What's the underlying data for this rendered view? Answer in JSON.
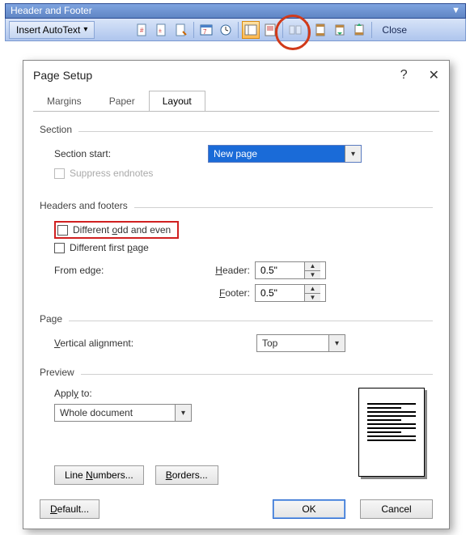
{
  "toolbar": {
    "title": "Header and Footer",
    "autotext_label": "Insert AutoText",
    "close_label": "Close"
  },
  "dialog": {
    "title": "Page Setup",
    "help_symbol": "?",
    "close_symbol": "✕",
    "tabs": {
      "margins": "Margins",
      "paper": "Paper",
      "layout": "Layout"
    },
    "section": {
      "group": "Section",
      "start_label": "Section start:",
      "start_value": "New page",
      "suppress_label": "Suppress endnotes"
    },
    "hf": {
      "group": "Headers and footers",
      "diff_oddeven": "Different odd and even",
      "diff_first": "Different first page",
      "from_edge": "From edge:",
      "header_label": "Header:",
      "header_value": "0.5\"",
      "footer_label": "Footer:",
      "footer_value": "0.5\""
    },
    "page": {
      "group": "Page",
      "valign_label": "Vertical alignment:",
      "valign_value": "Top"
    },
    "preview": {
      "group": "Preview",
      "apply_label": "Apply to:",
      "apply_value": "Whole document"
    },
    "buttons": {
      "line_numbers": "Line Numbers...",
      "borders": "Borders...",
      "default": "Default...",
      "ok": "OK",
      "cancel": "Cancel"
    }
  }
}
